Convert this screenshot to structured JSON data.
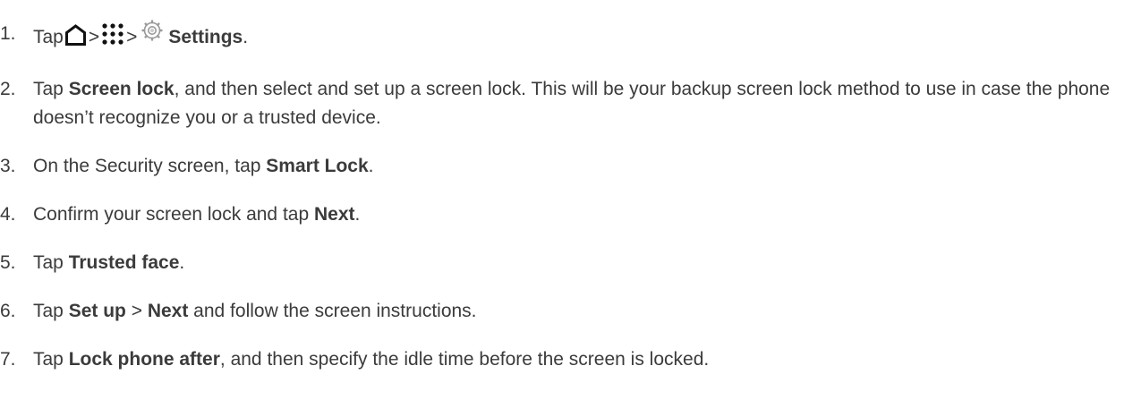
{
  "steps": [
    {
      "number": "1.",
      "parts": [
        {
          "t": "text",
          "v": "Tap"
        },
        {
          "t": "icon",
          "name": "home-icon"
        },
        {
          "t": "sep",
          "v": ">"
        },
        {
          "t": "icon",
          "name": "apps-icon"
        },
        {
          "t": "sep",
          "v": ">"
        },
        {
          "t": "icon",
          "name": "settings-gear-icon"
        },
        {
          "t": "bold",
          "v": "Settings"
        },
        {
          "t": "text",
          "v": "."
        }
      ]
    },
    {
      "number": "2.",
      "parts": [
        {
          "t": "text",
          "v": "Tap "
        },
        {
          "t": "bold",
          "v": "Screen lock"
        },
        {
          "t": "text",
          "v": ", and then select and set up a screen lock. This will be your backup screen lock method to use in case the phone doesn’t recognize you or a trusted device."
        }
      ]
    },
    {
      "number": "3.",
      "parts": [
        {
          "t": "text",
          "v": "On the Security screen, tap "
        },
        {
          "t": "bold",
          "v": "Smart Lock"
        },
        {
          "t": "text",
          "v": "."
        }
      ]
    },
    {
      "number": "4.",
      "parts": [
        {
          "t": "text",
          "v": "Confirm your screen lock and tap "
        },
        {
          "t": "bold",
          "v": "Next"
        },
        {
          "t": "text",
          "v": "."
        }
      ]
    },
    {
      "number": "5.",
      "parts": [
        {
          "t": "text",
          "v": "Tap "
        },
        {
          "t": "bold",
          "v": "Trusted face"
        },
        {
          "t": "text",
          "v": "."
        }
      ]
    },
    {
      "number": "6.",
      "parts": [
        {
          "t": "text",
          "v": "Tap "
        },
        {
          "t": "bold",
          "v": "Set up"
        },
        {
          "t": "text",
          "v": " > "
        },
        {
          "t": "bold",
          "v": "Next"
        },
        {
          "t": "text",
          "v": " and follow the screen instructions."
        }
      ]
    },
    {
      "number": "7.",
      "parts": [
        {
          "t": "text",
          "v": "Tap "
        },
        {
          "t": "bold",
          "v": "Lock phone after"
        },
        {
          "t": "text",
          "v": ", and then specify the idle time before the screen is locked."
        }
      ]
    }
  ]
}
